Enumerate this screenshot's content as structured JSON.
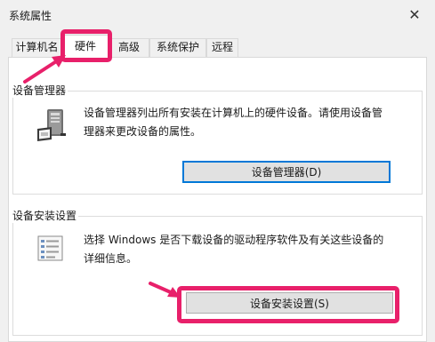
{
  "window": {
    "title": "系统属性"
  },
  "tabs": [
    {
      "label": "计算机名"
    },
    {
      "label": "硬件"
    },
    {
      "label": "高级"
    },
    {
      "label": "系统保护"
    },
    {
      "label": "远程"
    }
  ],
  "device_manager": {
    "group_label": "设备管理器",
    "description_line1": "设备管理器列出所有安装在计算机上的硬件设备。请使用设备管",
    "description_line2": "理器来更改设备的属性。",
    "button_label": "设备管理器(D)",
    "icon": "device-manager-icon"
  },
  "device_installation": {
    "group_label": "设备安装设置",
    "description_line1": "选择 Windows 是否下载设备的驱动程序软件及有关这些设备的",
    "description_line2": "详细信息。",
    "button_label": "设备安装设置(S)",
    "icon": "checklist-icon"
  },
  "highlight_color": "#e8206a",
  "focus_color": "#0078d7"
}
